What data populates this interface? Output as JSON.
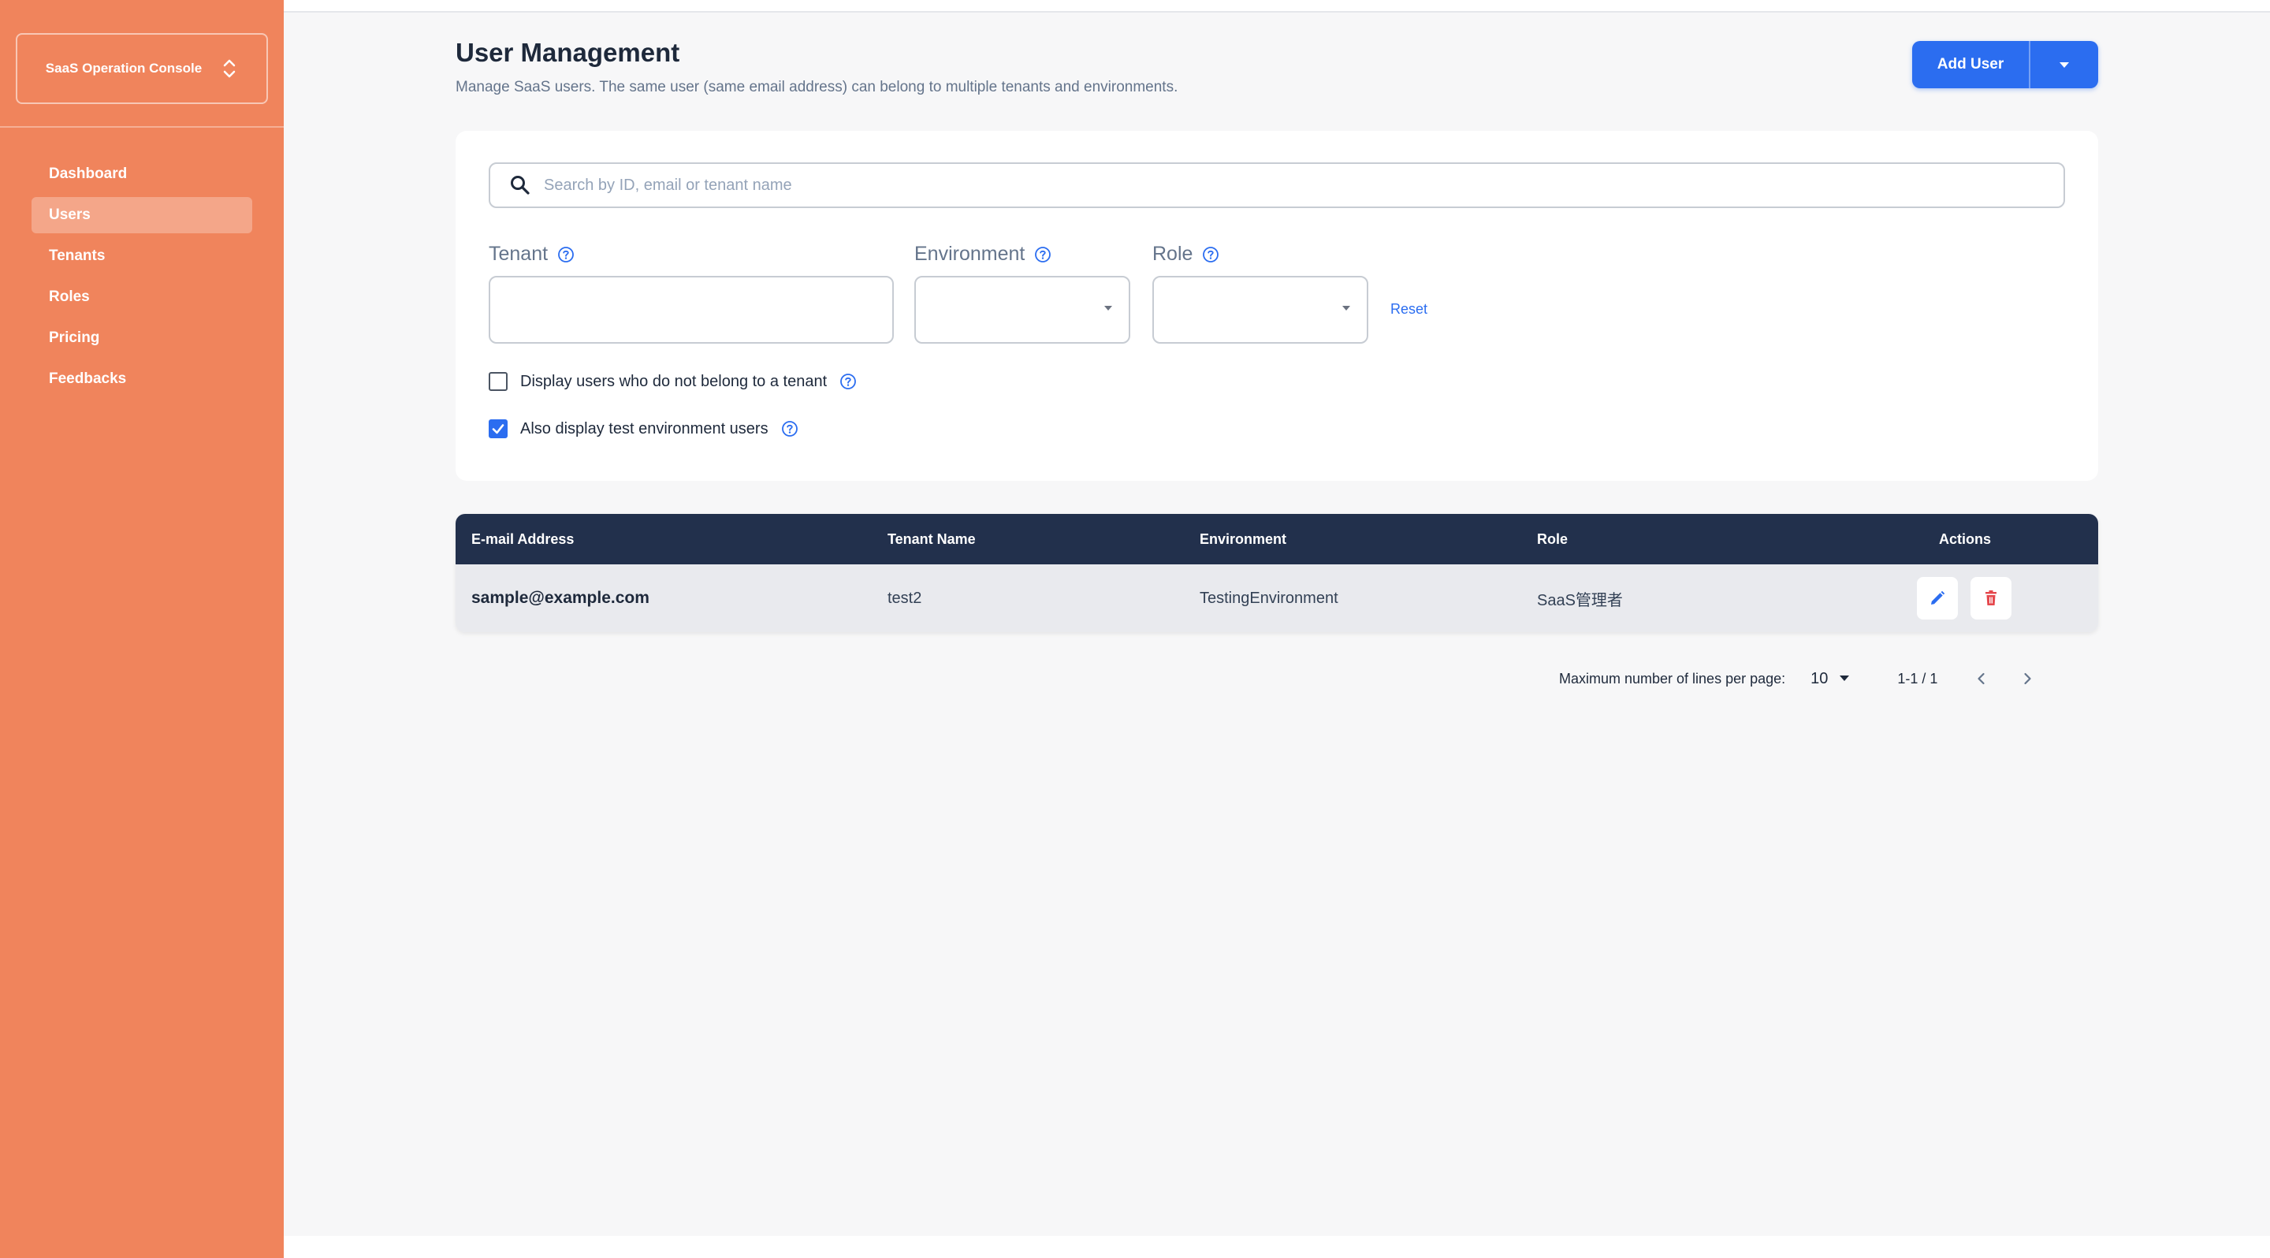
{
  "sidebar": {
    "console_name": "SaaS Operation Console",
    "items": [
      {
        "label": "Dashboard",
        "active": false
      },
      {
        "label": "Users",
        "active": true
      },
      {
        "label": "Tenants",
        "active": false
      },
      {
        "label": "Roles",
        "active": false
      },
      {
        "label": "Pricing",
        "active": false
      },
      {
        "label": "Feedbacks",
        "active": false
      }
    ]
  },
  "header": {
    "title": "User Management",
    "subtitle": "Manage SaaS users. The same user (same email address) can belong to multiple tenants and environments.",
    "add_user_label": "Add User"
  },
  "filters": {
    "search_placeholder": "Search by ID, email or tenant name",
    "search_value": "",
    "tenant_label": "Tenant",
    "environment_label": "Environment",
    "role_label": "Role",
    "reset_label": "Reset",
    "no_tenant_label": "Display users who do not belong to a tenant",
    "no_tenant_checked": false,
    "test_env_label": "Also display test environment users",
    "test_env_checked": true
  },
  "table": {
    "headers": [
      "E-mail Address",
      "Tenant Name",
      "Environment",
      "Role",
      "Actions"
    ],
    "rows": [
      {
        "email": "sample@example.com",
        "tenant": "test2",
        "environment": "TestingEnvironment",
        "role": "SaaS管理者"
      }
    ]
  },
  "pagination": {
    "rows_label": "Maximum number of lines per page:",
    "rows_per_page": "10",
    "range": "1-1 / 1"
  },
  "colors": {
    "sidebar": "#f0845c",
    "primary": "#2b6df0",
    "table_header": "#22304c",
    "delete": "#e5484d"
  }
}
